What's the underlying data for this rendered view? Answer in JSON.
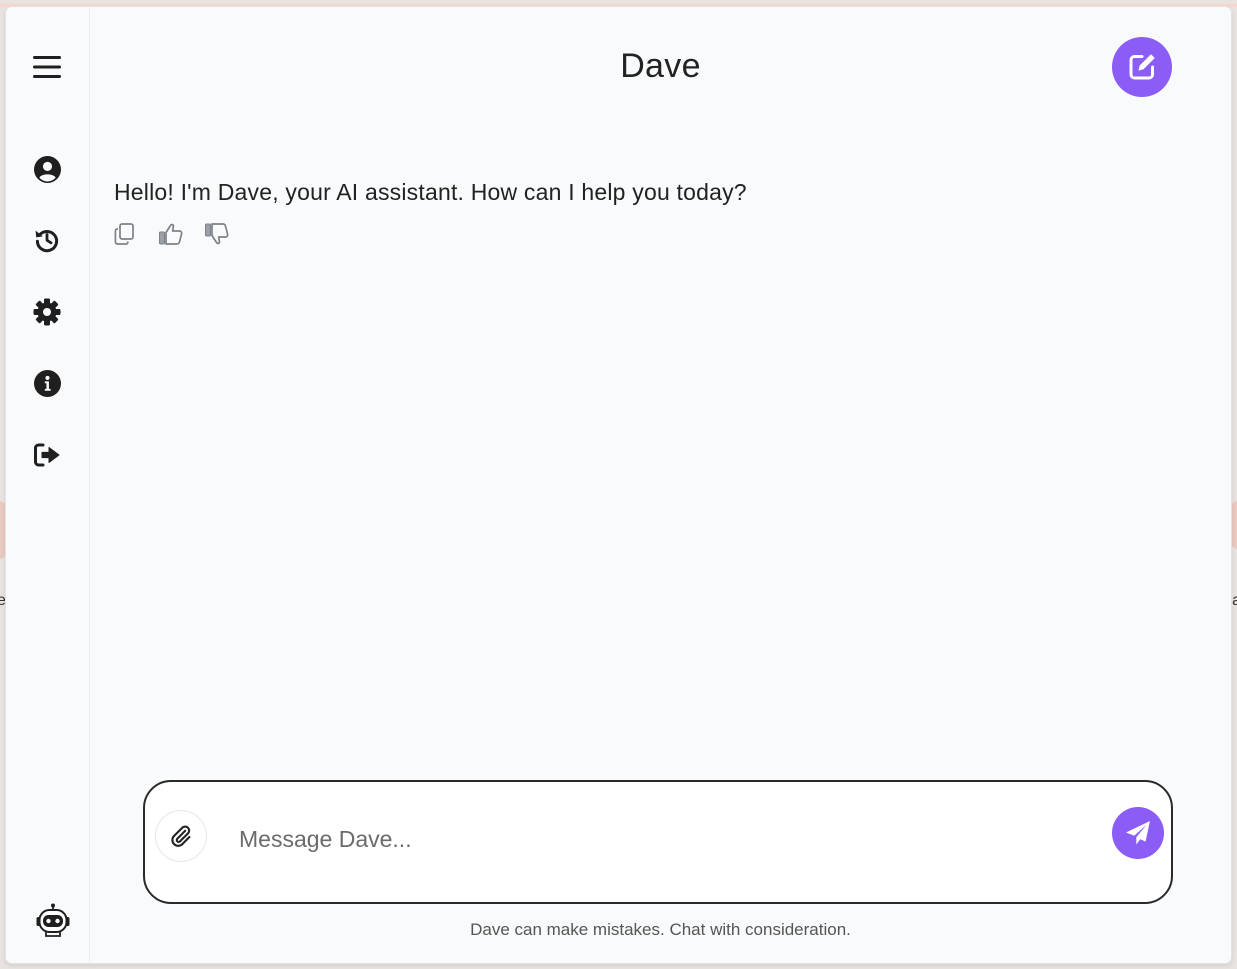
{
  "app": {
    "title": "Dave"
  },
  "sidebar": {
    "items": [
      {
        "name": "menu",
        "icon": "hamburger-menu-icon"
      },
      {
        "name": "profile",
        "icon": "user-circle-icon"
      },
      {
        "name": "history",
        "icon": "history-icon"
      },
      {
        "name": "settings",
        "icon": "gear-icon"
      },
      {
        "name": "info",
        "icon": "info-circle-icon"
      },
      {
        "name": "logout",
        "icon": "sign-out-icon"
      },
      {
        "name": "bot",
        "icon": "robot-icon"
      }
    ]
  },
  "header": {
    "new_chat_icon": "edit-square-icon",
    "accent": "#8b5cf6"
  },
  "chat": {
    "messages": [
      {
        "role": "assistant",
        "text": "Hello! I'm Dave, your AI assistant. How can I help you today?",
        "actions": [
          "copy-icon",
          "thumbs-up-icon",
          "thumbs-down-icon"
        ]
      }
    ]
  },
  "composer": {
    "placeholder": "Message Dave...",
    "value": "",
    "attach_icon": "paperclip-icon",
    "send_icon": "paper-plane-icon"
  },
  "footer": {
    "disclaimer": "Dave can make mistakes. Chat with consideration."
  }
}
